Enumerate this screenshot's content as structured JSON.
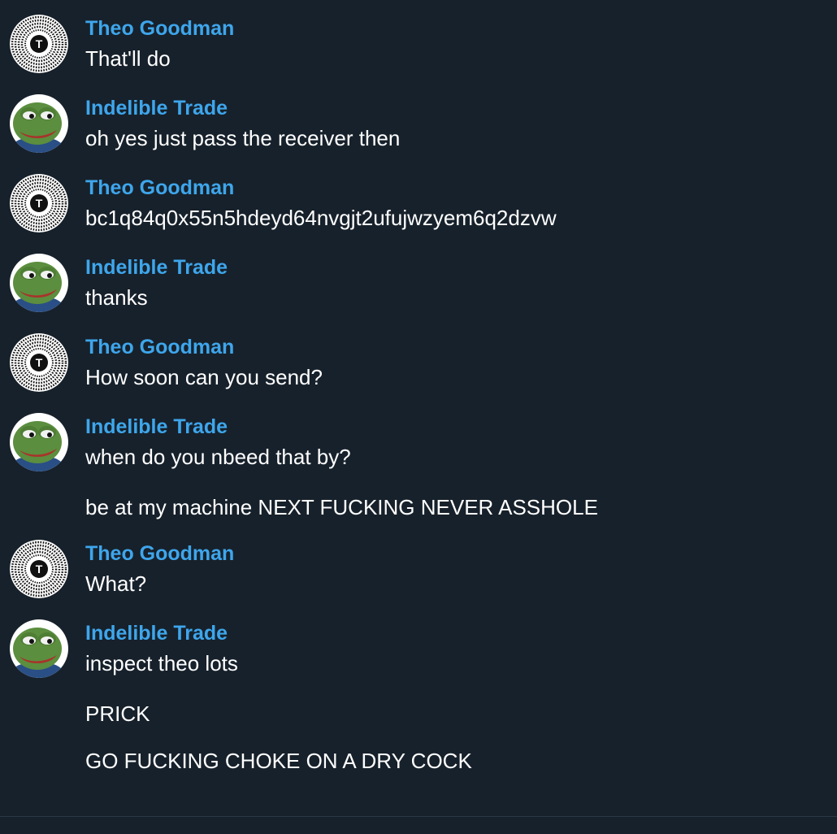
{
  "messages": [
    {
      "sender": "Theo Goodman",
      "avatar_icon": "theo-avatar-icon",
      "avatar_letter": "T",
      "lines": [
        "That'll do"
      ]
    },
    {
      "sender": "Indelible Trade",
      "avatar_icon": "pepe-frog-avatar-icon",
      "lines": [
        "oh yes just pass the receiver then"
      ]
    },
    {
      "sender": "Theo Goodman",
      "avatar_icon": "theo-avatar-icon",
      "avatar_letter": "T",
      "lines": [
        "bc1q84q0x55n5hdeyd64nvgjt2ufujwzyem6q2dzvw"
      ]
    },
    {
      "sender": "Indelible Trade",
      "avatar_icon": "pepe-frog-avatar-icon",
      "lines": [
        "thanks"
      ]
    },
    {
      "sender": "Theo Goodman",
      "avatar_icon": "theo-avatar-icon",
      "avatar_letter": "T",
      "lines": [
        "How soon can you send?"
      ]
    },
    {
      "sender": "Indelible Trade",
      "avatar_icon": "pepe-frog-avatar-icon",
      "lines": [
        "when do you nbeed that by?",
        "be at my machine NEXT FUCKING NEVER ASSHOLE"
      ]
    },
    {
      "sender": "Theo Goodman",
      "avatar_icon": "theo-avatar-icon",
      "avatar_letter": "T",
      "lines": [
        "What?"
      ]
    },
    {
      "sender": "Indelible Trade",
      "avatar_icon": "pepe-frog-avatar-icon",
      "lines": [
        "inspect theo lots",
        "PRICK",
        "GO FUCKING CHOKE ON A DRY COCK"
      ]
    }
  ],
  "colors": {
    "background": "#17212b",
    "sender_name": "#3ea6ec",
    "message_text": "#ffffff",
    "divider": "#2b3846"
  }
}
